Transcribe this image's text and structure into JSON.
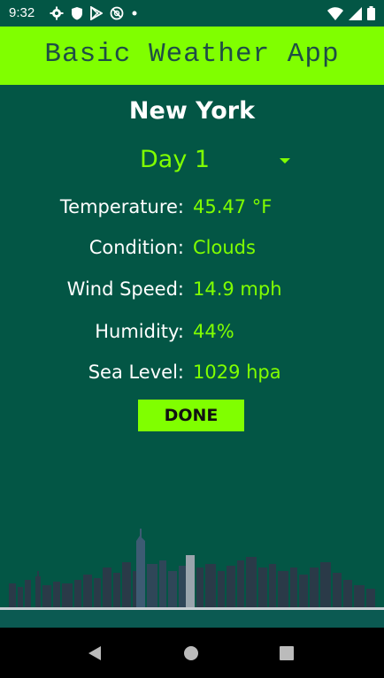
{
  "status_bar": {
    "time": "9:32",
    "left_icons": [
      "settings-icon",
      "shield-icon",
      "play-store-icon",
      "no-sync-icon",
      "dot-icon"
    ],
    "right_icons": [
      "wifi-icon",
      "signal-icon",
      "battery-icon"
    ]
  },
  "app_bar": {
    "title": "Basic Weather App"
  },
  "city": "New York",
  "day_selector": {
    "selected": "Day 1"
  },
  "weather": [
    {
      "label": "Temperature:",
      "value": "45.47 °F"
    },
    {
      "label": "Condition:",
      "value": "Clouds"
    },
    {
      "label": "Wind Speed:",
      "value": "14.9 mph"
    },
    {
      "label": "Humidity:",
      "value": "44%"
    },
    {
      "label": "Sea Level:",
      "value": "1029 hpa"
    }
  ],
  "done_button": "DONE",
  "colors": {
    "background": "#035645",
    "accent": "#80ff00",
    "title_text": "#1e4e45",
    "text": "#ffffff",
    "nav_bar": "#000000"
  },
  "nav_bar": {
    "icons": [
      "back-icon",
      "home-icon",
      "recents-icon"
    ]
  }
}
